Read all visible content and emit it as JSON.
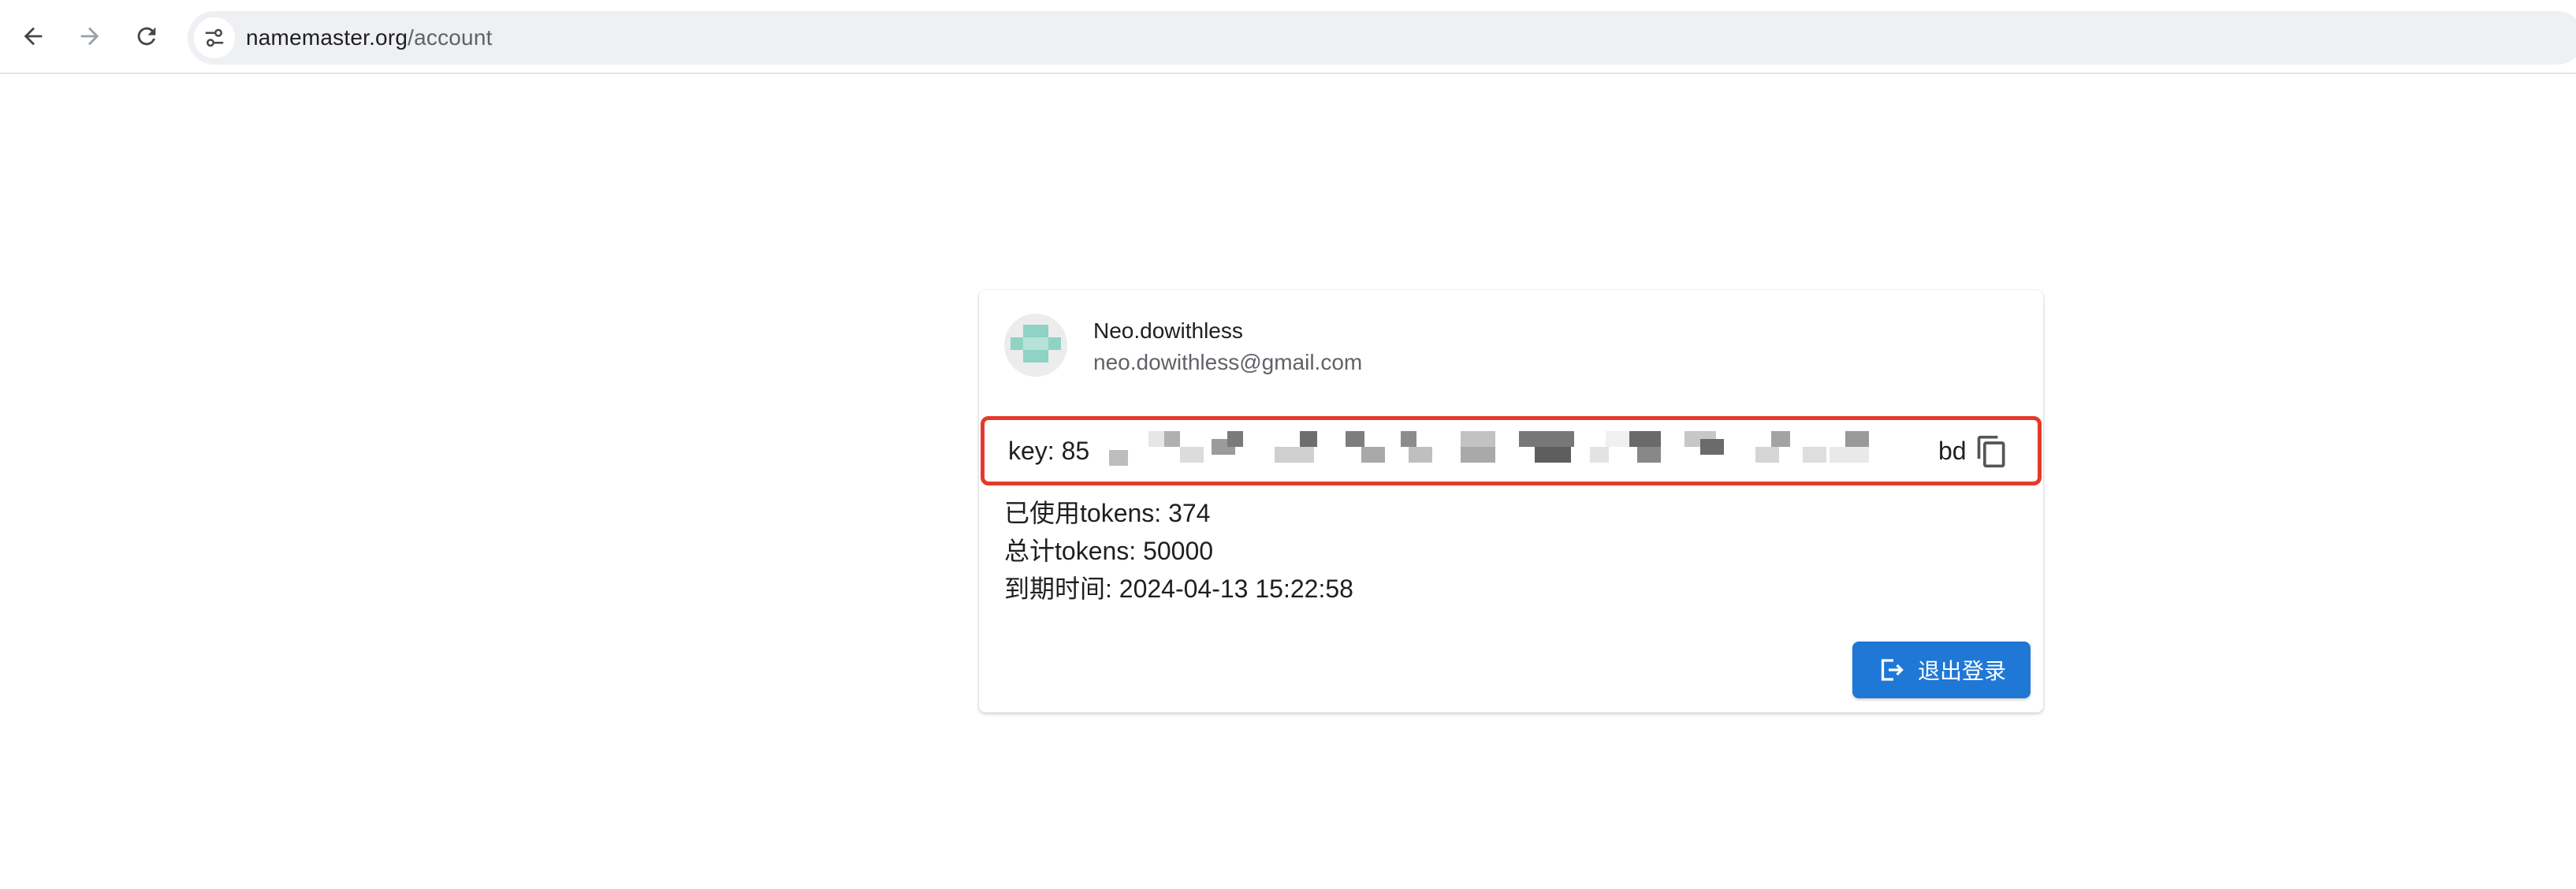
{
  "browser": {
    "url_domain": "namemaster.org",
    "url_path": "/account",
    "icons": {
      "back": "back-arrow-icon",
      "forward": "forward-arrow-icon",
      "reload": "reload-icon",
      "site_info": "tune-icon"
    }
  },
  "account": {
    "name": "Neo.dowithless",
    "email": "neo.dowithless@gmail.com",
    "avatar_color": "#8ed3c3",
    "key_label": "key: 85",
    "key_tail": "bd",
    "key_highlight_color": "#e53a2b",
    "copy_icon": "copy-icon",
    "tokens_used": "已使用tokens: 374",
    "tokens_total": "总计tokens: 50000",
    "expiry": "到期时间: 2024-04-13 15:22:58",
    "logout_label": "退出登录",
    "logout_icon": "logout-icon",
    "logout_color": "#1f78d6"
  }
}
